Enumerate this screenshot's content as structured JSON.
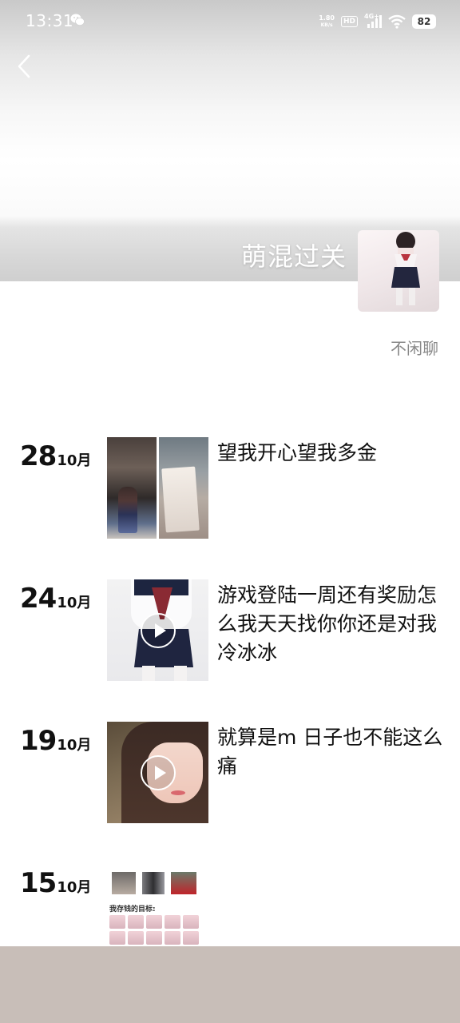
{
  "status_bar": {
    "time": "13:31",
    "net_speed_value": "1.80",
    "net_speed_unit": "KB/s",
    "hd_label": "HD",
    "network_label": "4G+",
    "battery": "82"
  },
  "profile": {
    "name": "萌混过关",
    "signature": "不闲聊"
  },
  "feed": [
    {
      "day": "28",
      "month": "10月",
      "text": "望我开心望我多金",
      "media": "photo"
    },
    {
      "day": "24",
      "month": "10月",
      "text": "游戏登陆一周还有奖励怎么我天天找你你还是对我冷冰冰",
      "media": "video"
    },
    {
      "day": "19",
      "month": "10月",
      "text": "就算是m 日子也不能这么痛",
      "media": "video"
    },
    {
      "day": "15",
      "month": "10月",
      "text": "",
      "media": "photo",
      "image_caption": "我存钱的目标:"
    }
  ],
  "colors": {
    "accent_text": "#111111",
    "secondary_text": "#888888",
    "bottom_bar": "#c8beb8"
  }
}
